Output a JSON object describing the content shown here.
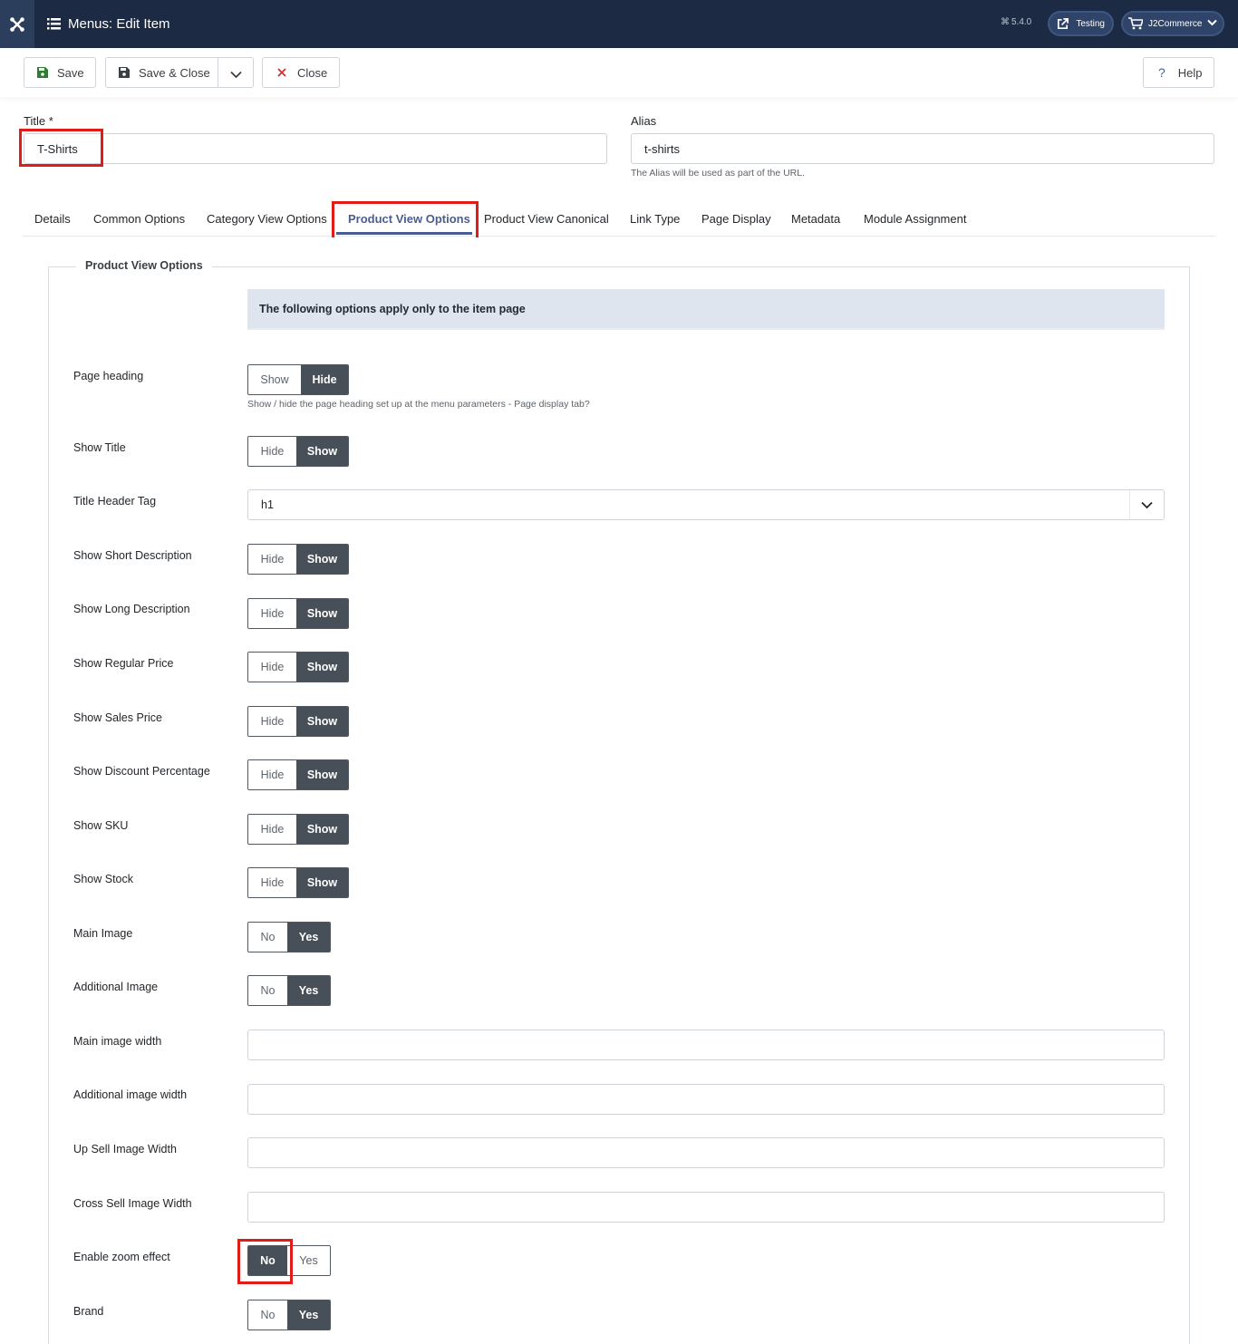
{
  "header": {
    "title": "Menus: Edit Item",
    "version": "5.4.0",
    "site_button": "Testing",
    "user_button": "J2Commerce"
  },
  "toolbar": {
    "save_label": "Save",
    "save_close_label": "Save & Close",
    "close_label": "Close",
    "help_label": "Help"
  },
  "form": {
    "title_label": "Title *",
    "title_value": "T-Shirts",
    "alias_label": "Alias",
    "alias_value": "t-shirts",
    "alias_hint": "The Alias will be used as part of the URL."
  },
  "tabs": [
    {
      "label": "Details"
    },
    {
      "label": "Common Options"
    },
    {
      "label": "Category View Options"
    },
    {
      "label": "Product View Options",
      "active": true
    },
    {
      "label": "Product View Canonical"
    },
    {
      "label": "Link Type"
    },
    {
      "label": "Page Display"
    },
    {
      "label": "Metadata"
    },
    {
      "label": "Module Assignment"
    }
  ],
  "section": {
    "legend": "Product View Options",
    "alert": "The following options apply only to the item page"
  },
  "options": {
    "page_heading": {
      "label": "Page heading",
      "a": "Show",
      "b": "Hide",
      "selected": "Hide",
      "hint": "Show / hide the page heading set up at the menu parameters - Page display tab?"
    },
    "show_title": {
      "label": "Show Title",
      "a": "Hide",
      "b": "Show",
      "selected": "Show"
    },
    "title_header_tag": {
      "label": "Title Header Tag",
      "value": "h1"
    },
    "show_short_desc": {
      "label": "Show Short Description",
      "a": "Hide",
      "b": "Show",
      "selected": "Show"
    },
    "show_long_desc": {
      "label": "Show Long Description",
      "a": "Hide",
      "b": "Show",
      "selected": "Show"
    },
    "show_regular_price": {
      "label": "Show Regular Price",
      "a": "Hide",
      "b": "Show",
      "selected": "Show"
    },
    "show_sales_price": {
      "label": "Show Sales Price",
      "a": "Hide",
      "b": "Show",
      "selected": "Show"
    },
    "show_discount": {
      "label": "Show Discount Percentage",
      "a": "Hide",
      "b": "Show",
      "selected": "Show"
    },
    "show_sku": {
      "label": "Show SKU",
      "a": "Hide",
      "b": "Show",
      "selected": "Show"
    },
    "show_stock": {
      "label": "Show Stock",
      "a": "Hide",
      "b": "Show",
      "selected": "Show"
    },
    "main_image": {
      "label": "Main Image",
      "a": "No",
      "b": "Yes",
      "selected": "Yes"
    },
    "additional_image": {
      "label": "Additional Image",
      "a": "No",
      "b": "Yes",
      "selected": "Yes"
    },
    "main_image_width": {
      "label": "Main image width",
      "value": ""
    },
    "additional_image_width": {
      "label": "Additional image width",
      "value": ""
    },
    "up_sell_width": {
      "label": "Up Sell Image Width",
      "value": ""
    },
    "cross_sell_width": {
      "label": "Cross Sell Image Width",
      "value": ""
    },
    "zoom_effect": {
      "label": "Enable zoom effect",
      "a": "No",
      "b": "Yes",
      "selected": "No"
    },
    "brand": {
      "label": "Brand",
      "a": "No",
      "b": "Yes",
      "selected": "Yes"
    }
  },
  "colors": {
    "header_bg": "#1c2b43",
    "active_tab": "#4b5c92",
    "toggle_on": "#474f58",
    "highlight": "#e11a1a"
  }
}
